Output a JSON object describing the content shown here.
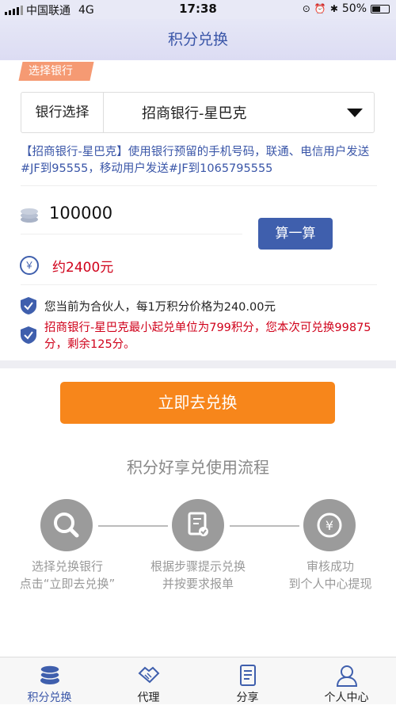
{
  "status": {
    "carrier": "中国联通",
    "network": "4G",
    "time": "17:38",
    "battery": "50%"
  },
  "nav": {
    "title": "积分兑换"
  },
  "bank": {
    "tag": "选择银行",
    "label": "银行选择",
    "selected": "招商银行-星巴克",
    "info": "【招商银行-星巴克】使用银行预留的手机号码，联通、电信用户发送#JF到95555，移动用户发送#JF到1065795555"
  },
  "calc": {
    "points": "100000",
    "button": "算一算",
    "estimate": "约2400元"
  },
  "notes": {
    "partner": "您当前为合伙人，每1万积分价格为240.00元",
    "limit": "招商银行-星巴克最小起兑单位为799积分，您本次可兑换99875分，剩余125分。"
  },
  "action": {
    "button": "立即去兑换"
  },
  "process": {
    "title": "积分好享兑使用流程",
    "steps": [
      {
        "line1": "选择兑换银行",
        "line2": "点击“立即去兑换”"
      },
      {
        "line1": "根据步骤提示兑换",
        "line2": "并按要求报单"
      },
      {
        "line1": "审核成功",
        "line2": "到个人中心提现"
      }
    ]
  },
  "tabs": [
    "积分兑换",
    "代理",
    "分享",
    "个人中心"
  ],
  "colors": {
    "accent": "#3f5fad",
    "orange": "#f7861b",
    "red": "#d0021b",
    "tag": "#f59a73"
  }
}
